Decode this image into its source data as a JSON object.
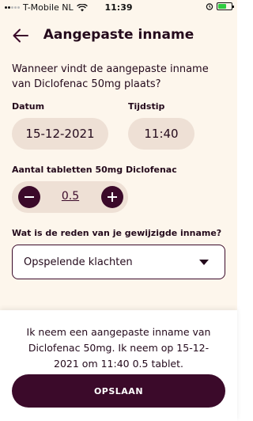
{
  "status_bar": {
    "carrier": "T-Mobile NL",
    "time": "11:39",
    "battery_color": "#2ecc40"
  },
  "header": {
    "title": "Aangepaste inname",
    "back_icon": "arrow-left-icon"
  },
  "question": "Wanneer vindt de aangepaste inname van Diclofenac 50mg plaats?",
  "date_field": {
    "label": "Datum",
    "value": "15-12-2021"
  },
  "time_field": {
    "label": "Tijdstip",
    "value": "11:40"
  },
  "tablets": {
    "label": "Aantal tabletten 50mg Diclofenac",
    "value": "0.5"
  },
  "reason": {
    "label": "Wat is de reden van je gewijzigde inname?",
    "selected": "Opspelende klachten"
  },
  "summary": "Ik neem een aangepaste inname van Diclofenac 50mg. Ik neem op 15-12-2021 om 11:40 0.5 tablet.",
  "save_label": "OPSLAAN",
  "colors": {
    "primary": "#3b0a2a",
    "background": "#fdf6ec",
    "pill": "#eee0d5"
  }
}
